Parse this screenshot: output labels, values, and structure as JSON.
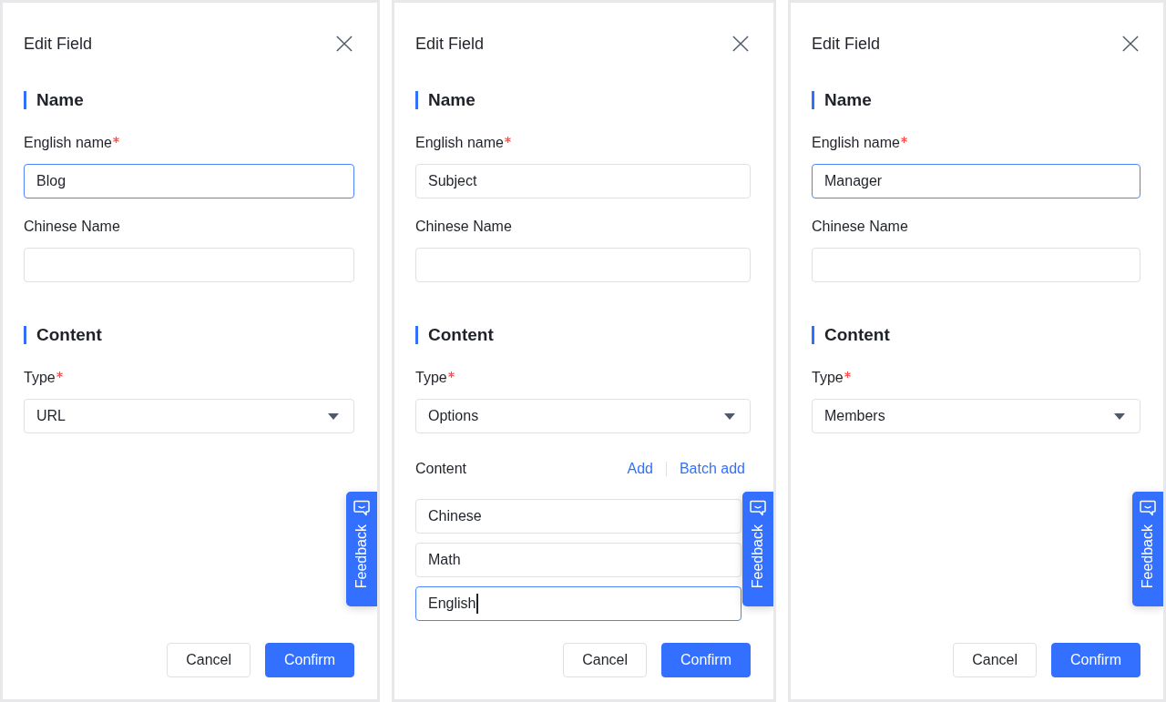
{
  "panels": [
    {
      "title": "Edit Field",
      "sections": [
        {
          "heading": "Name",
          "fields": [
            {
              "kind": "text",
              "label": "English name",
              "required": true,
              "value": "Blog",
              "focused": true
            },
            {
              "kind": "text",
              "label": "Chinese Name",
              "required": false,
              "focused": false
            }
          ]
        },
        {
          "heading": "Content",
          "fields": [
            {
              "kind": "select",
              "label": "Type",
              "required": true,
              "value": "URL",
              "focused": false
            }
          ]
        }
      ],
      "buttons": [
        {
          "kind": "secondary",
          "label": "Cancel"
        },
        {
          "kind": "primary",
          "label": "Confirm"
        }
      ],
      "feedback_tab": {
        "label": "Feedback"
      }
    },
    {
      "title": "Edit Field",
      "sections": [
        {
          "heading": "Name",
          "fields": [
            {
              "kind": "text",
              "label": "English name",
              "required": true,
              "value": "Subject",
              "focused": false
            },
            {
              "kind": "text",
              "label": "Chinese Name",
              "required": false,
              "focused": false
            }
          ]
        },
        {
          "heading": "Content",
          "fields": [
            {
              "kind": "select",
              "label": "Type",
              "required": true,
              "value": "Options",
              "focused": false
            },
            {
              "kind": "options",
              "label": "Content",
              "required": false,
              "actions": [
                "Add",
                "Batch add"
              ],
              "items": [
                {
                  "value": "Chinese",
                  "focused": false,
                  "cursor": false
                },
                {
                  "value": "Math",
                  "focused": false,
                  "cursor": false
                },
                {
                  "value": "English",
                  "focused": true,
                  "cursor": true
                }
              ]
            }
          ]
        }
      ],
      "buttons": [
        {
          "kind": "secondary",
          "label": "Cancel"
        },
        {
          "kind": "primary",
          "label": "Confirm"
        }
      ],
      "feedback_tab": {
        "label": "Feedback"
      }
    },
    {
      "title": "Edit Field",
      "sections": [
        {
          "heading": "Name",
          "fields": [
            {
              "kind": "text",
              "label": "English name",
              "required": true,
              "value": "Manager",
              "focused": true
            },
            {
              "kind": "text",
              "label": "Chinese Name",
              "required": false,
              "focused": false
            }
          ]
        },
        {
          "heading": "Content",
          "fields": [
            {
              "kind": "select",
              "label": "Type",
              "required": true,
              "value": "Members",
              "focused": false
            }
          ]
        }
      ],
      "buttons": [
        {
          "kind": "secondary",
          "label": "Cancel"
        },
        {
          "kind": "primary",
          "label": "Confirm"
        }
      ],
      "feedback_tab": {
        "label": "Feedback"
      }
    }
  ]
}
